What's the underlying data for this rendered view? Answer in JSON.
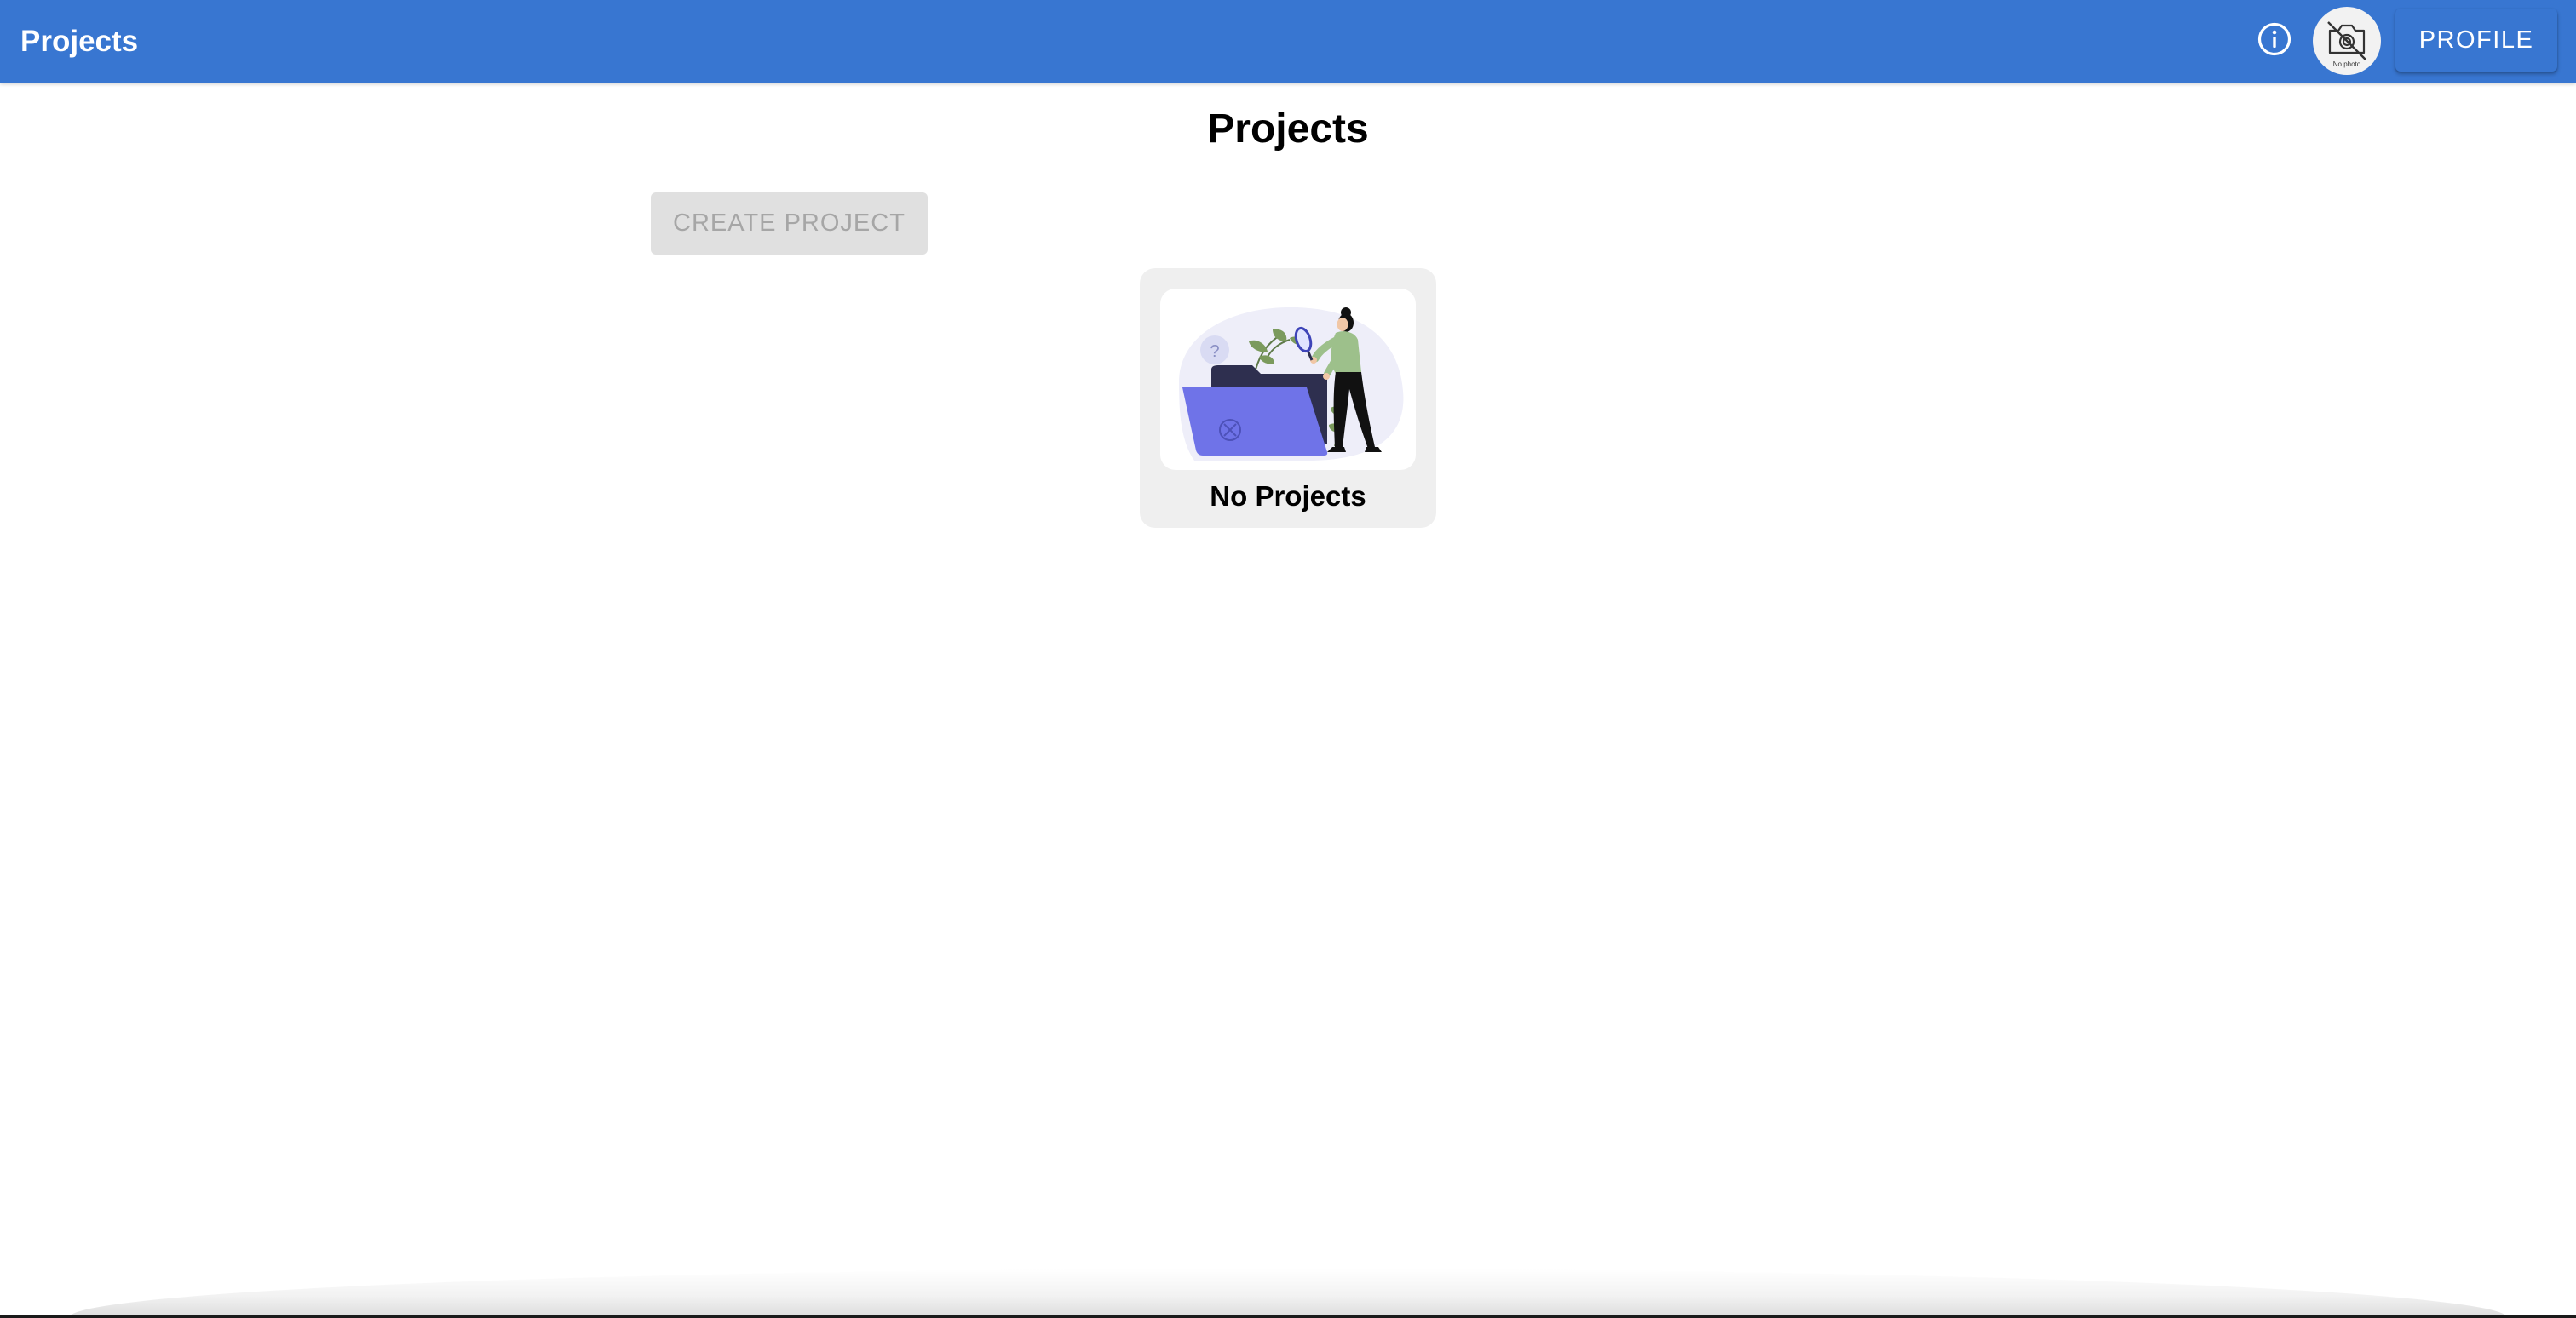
{
  "app_bar": {
    "title": "Projects",
    "info_icon": "info-icon",
    "avatar": {
      "icon": "no-photo-camera-icon",
      "caption": "No photo"
    },
    "profile_label": "PROFILE"
  },
  "main": {
    "heading": "Projects",
    "create_button_label": "CREATE PROJECT",
    "create_button_disabled": true,
    "empty_state": {
      "label": "No Projects",
      "illustration": "empty-folder-search-illustration"
    }
  },
  "colors": {
    "primary": "#3876d1",
    "disabled_button_bg": "#e0e0e0",
    "disabled_button_text": "#a6a6a6",
    "card_bg": "#efefef",
    "folder_purple": "#6f73e8",
    "folder_dark": "#2e2f4f"
  }
}
